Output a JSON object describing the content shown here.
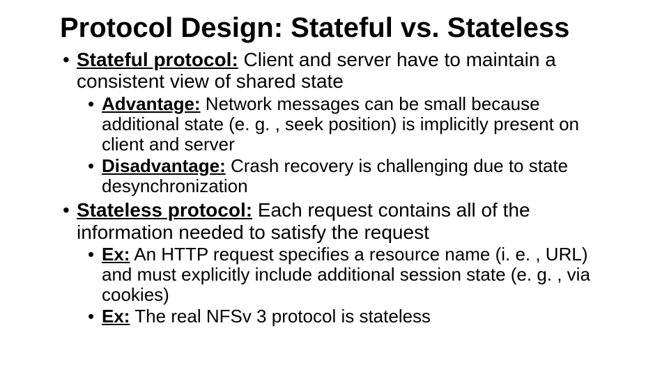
{
  "slide": {
    "title": "Protocol Design: Stateful vs. Stateless",
    "items": [
      {
        "lead": "Stateful protocol:",
        "rest": " Client and server have to maintain a consistent view of shared state",
        "sub": [
          {
            "lead": "Advantage:",
            "rest": " Network messages can be small because additional state (e. g. , seek position) is implicitly present on client and server"
          },
          {
            "lead": "Disadvantage:",
            "rest": " Crash recovery is challenging due to state desynchronization"
          }
        ]
      },
      {
        "lead": "Stateless protocol:",
        "rest": " Each request contains all of the information needed to satisfy the request",
        "sub": [
          {
            "lead": "Ex:",
            "rest": " An HTTP request specifies a resource name (i. e. , URL) and must explicitly include additional session state (e. g. , via cookies)"
          },
          {
            "lead": "Ex:",
            "rest": " The real NFSv 3 protocol is stateless"
          }
        ]
      }
    ]
  }
}
